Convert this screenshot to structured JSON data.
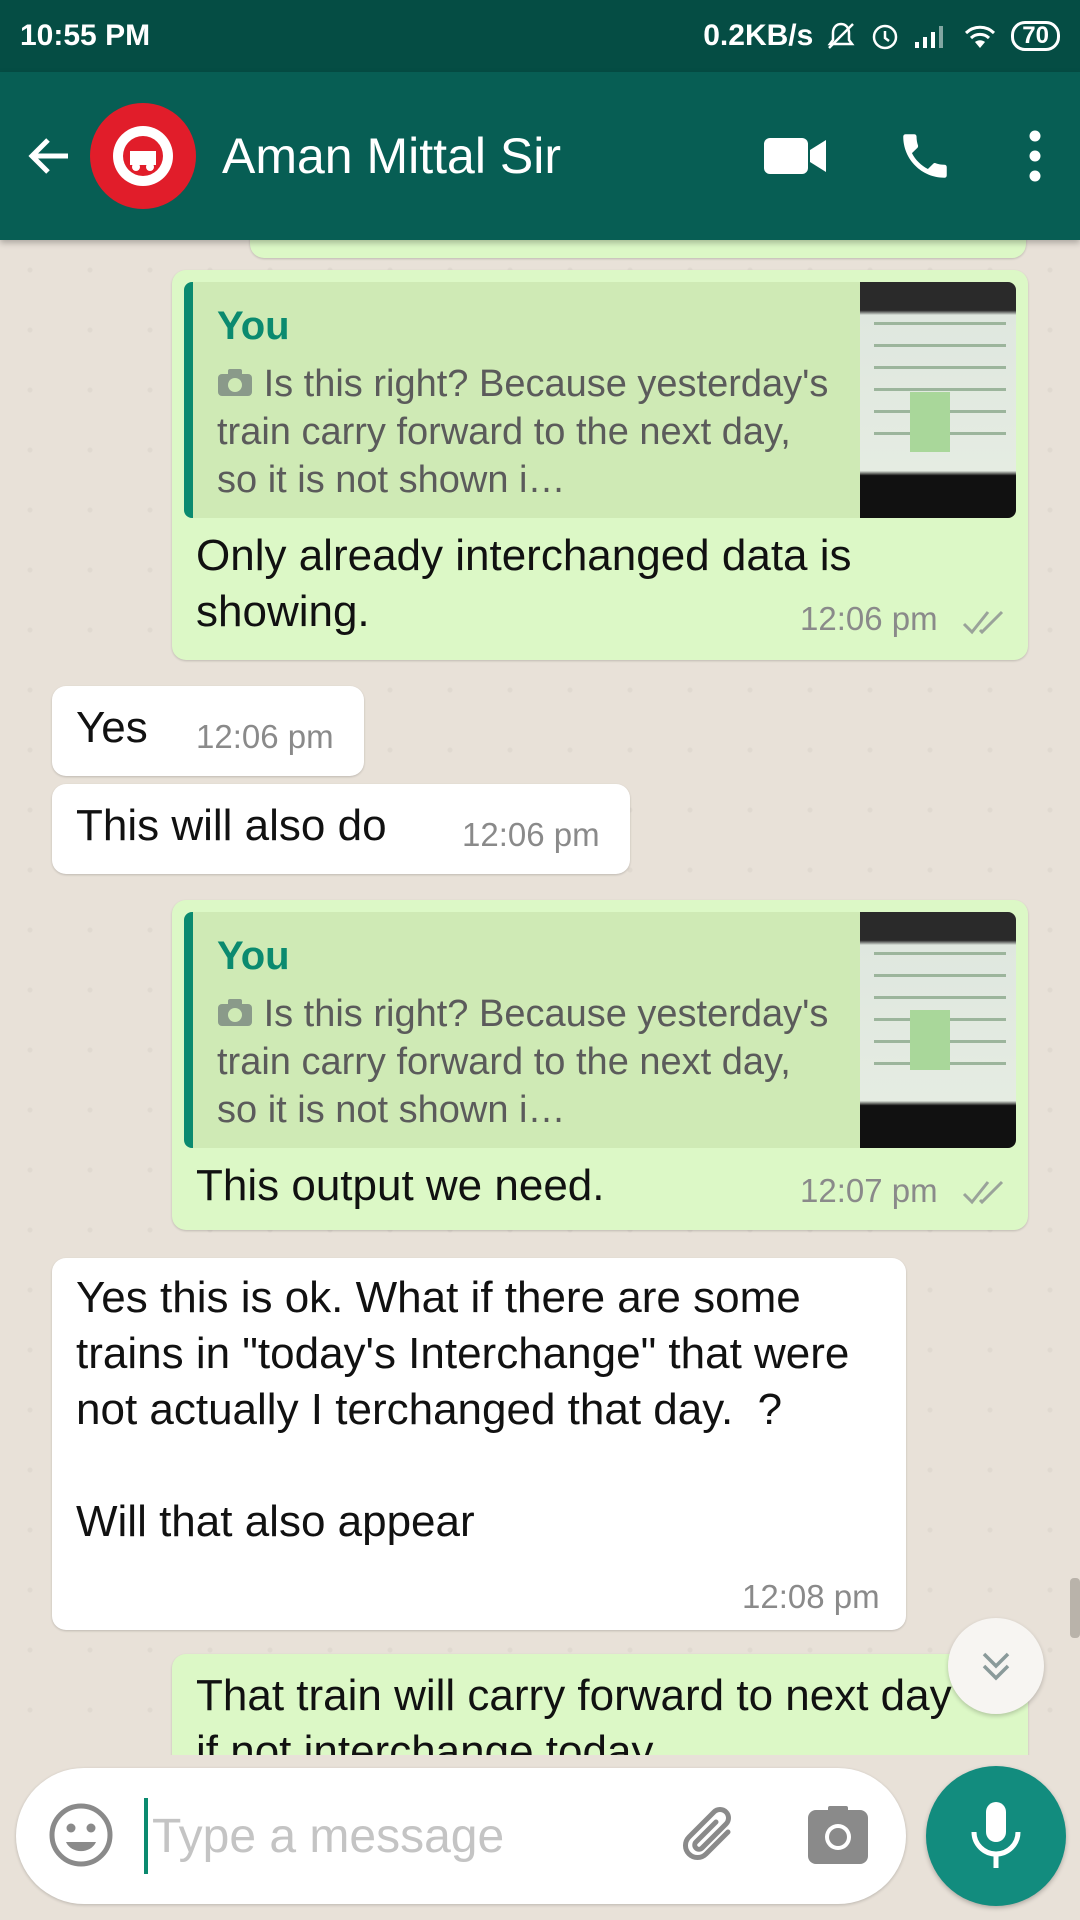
{
  "status_bar": {
    "time": "10:55 PM",
    "net_speed": "0.2KB/s",
    "battery": "70"
  },
  "header": {
    "contact_name": "Aman Mittal Sir"
  },
  "messages": [
    {
      "direction": "outgoing",
      "quote_author": "You",
      "quote_text": "Is this right? Because yesterday's train carry forward to the next day, so it is not shown i…",
      "text": "Only already interchanged data is showing.",
      "time": "12:06 pm"
    },
    {
      "direction": "incoming",
      "text": "Yes",
      "time": "12:06 pm"
    },
    {
      "direction": "incoming",
      "text": "This will also do",
      "time": "12:06 pm"
    },
    {
      "direction": "outgoing",
      "quote_author": "You",
      "quote_text": "Is this right? Because yesterday's train carry forward to the next day, so it is not shown i…",
      "text": "This output we need.",
      "time": "12:07 pm"
    },
    {
      "direction": "incoming",
      "text": "Yes this is ok. What if there are some trains in \"today's Interchange\" that were not actually I terchanged that day.  ?\n\nWill that also appear",
      "time": "12:08 pm"
    },
    {
      "direction": "outgoing",
      "text": "That train will carry forward to next day if not interchange today."
    }
  ],
  "composer": {
    "placeholder": "Type a message"
  },
  "colors": {
    "header": "#075e54",
    "status_bar": "#054d44",
    "outgoing_bubble": "#dcf8c6",
    "incoming_bubble": "#ffffff",
    "accent": "#128c7e",
    "background": "#e8e1d8"
  },
  "icons": [
    "back-arrow-icon",
    "video-call-icon",
    "phone-icon",
    "more-icon",
    "camera-icon",
    "double-tick-icon",
    "scroll-down-icon",
    "emoji-icon",
    "attach-icon",
    "mic-icon"
  ]
}
